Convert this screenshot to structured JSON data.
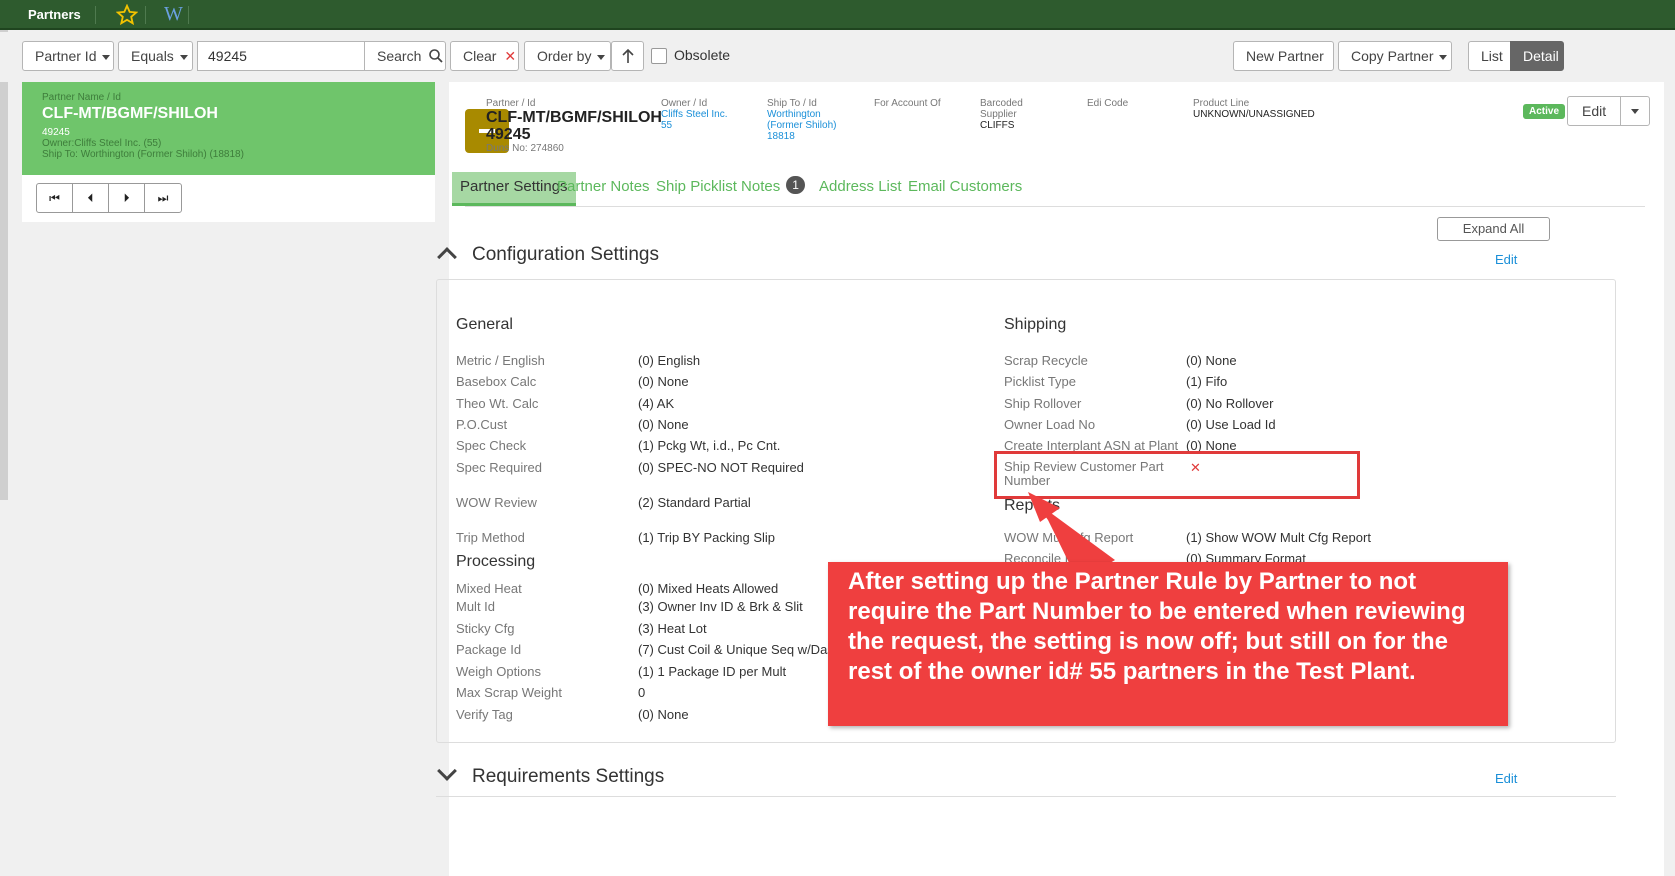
{
  "topbar": {
    "title": "Partners",
    "favorite_icon": "star-icon",
    "wiki_label": "W"
  },
  "toolbar": {
    "field_select": "Partner Id",
    "operator_select": "Equals",
    "search_value": "49245",
    "search_label": "Search",
    "clear_label": "Clear",
    "order_by_label": "Order by",
    "obsolete_label": "Obsolete",
    "new_partner_label": "New Partner",
    "copy_partner_label": "Copy Partner",
    "list_label": "List",
    "detail_label": "Detail"
  },
  "left_card": {
    "name_label": "Partner Name / Id",
    "name": "CLF-MT/BGMF/SHILOH",
    "id": "49245",
    "owner": "Owner:Cliffs Steel Inc. (55)",
    "ship_to": "Ship To: Worthington (Former Shiloh) (18818)"
  },
  "header": {
    "partner_label": "Partner / Id",
    "partner_name": "CLF-MT/BGMF/SHILOH",
    "partner_id": "49245",
    "duns": "Duns No: 274860",
    "owner_label": "Owner / Id",
    "owner_name": "Cliffs Steel Inc.",
    "owner_id": "55",
    "shipto_label": "Ship To / Id",
    "shipto_name1": "Worthington",
    "shipto_name2": "(Former Shiloh)",
    "shipto_id": "18818",
    "account_label": "For Account Of",
    "barcoded_label1": "Barcoded",
    "barcoded_label2": "Supplier",
    "barcoded_value": "CLIFFS",
    "edi_label": "Edi Code",
    "product_label": "Product Line",
    "product_value": "UNKNOWN/UNASSIGNED",
    "status": "Active",
    "edit_label": "Edit"
  },
  "tabs": [
    {
      "label": "Partner Settings"
    },
    {
      "label": "Partner Notes"
    },
    {
      "label": "Ship Picklist Notes",
      "count": "1"
    },
    {
      "label": "Address List"
    },
    {
      "label": "Email Customers"
    }
  ],
  "expand_all_label": "Expand All",
  "config": {
    "title": "Configuration Settings",
    "edit_label": "Edit",
    "general_title": "General",
    "general": [
      {
        "k": "Metric / English",
        "v": "(0) English"
      },
      {
        "k": "Basebox Calc",
        "v": "(0) None"
      },
      {
        "k": "Theo Wt. Calc",
        "v": "(4) AK"
      },
      {
        "k": "P.O.Cust",
        "v": "(0) None"
      },
      {
        "k": "Spec Check",
        "v": "(1) Pckg Wt, i.d., Pc Cnt."
      },
      {
        "k": "Spec Required",
        "v": "(0) SPEC-NO NOT Required"
      },
      {
        "k": "WOW Review",
        "v": "(2) Standard Partial"
      },
      {
        "k": "Trip Method",
        "v": "(1) Trip BY Packing Slip"
      }
    ],
    "processing_title": "Processing",
    "processing": [
      {
        "k": "Mixed Heat",
        "v": "(0) Mixed Heats Allowed"
      },
      {
        "k": "Mult Id",
        "v": "(3) Owner Inv ID & Brk & Slit"
      },
      {
        "k": "Sticky Cfg",
        "v": "(3) Heat Lot"
      },
      {
        "k": "Package Id",
        "v": "(7) Cust Coil & Unique Seq w/Das"
      },
      {
        "k": "Weigh Options",
        "v": "(1) 1 Package ID per Mult"
      },
      {
        "k": "Max Scrap Weight",
        "v": "0"
      },
      {
        "k": "Verify Tag",
        "v": "(0) None"
      }
    ],
    "shipping_title": "Shipping",
    "shipping": [
      {
        "k": "Scrap Recycle",
        "v": "(0) None"
      },
      {
        "k": "Picklist Type",
        "v": "(1) Fifo"
      },
      {
        "k": "Ship Rollover",
        "v": "(0) No Rollover"
      },
      {
        "k": "Owner Load No",
        "v": "(0) Use Load Id"
      },
      {
        "k": "Create Interplant ASN at Plant",
        "v": "(0) None"
      }
    ],
    "ship_review_k1": "Ship Review Customer Part",
    "ship_review_k2": "Number",
    "ship_review_v": "✕",
    "reports_title": "Reports",
    "reports": [
      {
        "k": "WOW Mult Cfg Report",
        "v": "(1) Show WOW Mult Cfg Report"
      },
      {
        "k": "Reconcile By",
        "v": "(0) Summary Format"
      }
    ]
  },
  "requirements": {
    "title": "Requirements Settings",
    "edit_label": "Edit"
  },
  "callout_text": "After setting up the Partner Rule by Partner to not require the Part Number to be entered when reviewing the request, the setting is now off; but still on for the rest of the owner id# 55 partners in the Test Plant.",
  "colors": {
    "topbar": "#2e5b2e",
    "accent_green": "#5cb85c",
    "card_green": "#6fc56b",
    "link_blue": "#1a8fd8",
    "callout_red": "#ef3f3f"
  }
}
